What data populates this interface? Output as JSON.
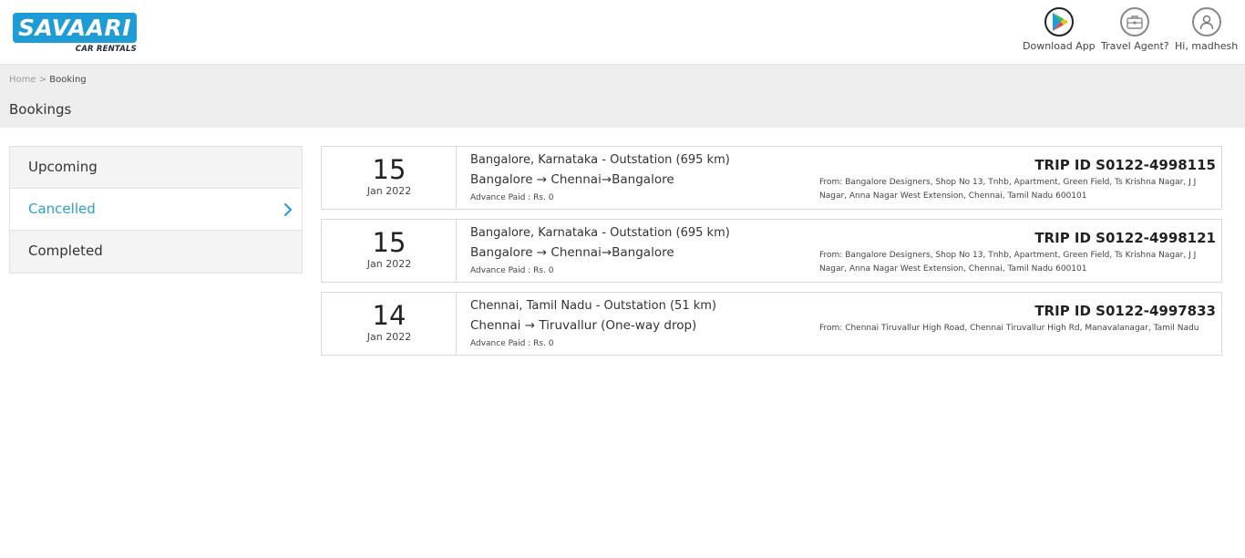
{
  "brand": {
    "name": "SAVAARI",
    "tagline": "CAR RENTALS",
    "color": "#1e9cd7"
  },
  "header": {
    "download_app": "Download App",
    "travel_agent": "Travel Agent?",
    "greeting": "Hi, madhesh"
  },
  "breadcrumb": {
    "home": "Home",
    "separator": ">",
    "current": "Booking"
  },
  "page_title": "Bookings",
  "sidebar": {
    "active_color": "#2b9fd3",
    "items": [
      {
        "label": "Upcoming"
      },
      {
        "label": "Cancelled"
      },
      {
        "label": "Completed"
      }
    ]
  },
  "bookings": [
    {
      "day": "15",
      "month_year": "Jan 2022",
      "route_title": "Bangalore, Karnataka - Outstation (695 km)",
      "path": "Bangalore → Chennai→Bangalore",
      "advance": "Advance Paid : Rs. 0",
      "trip_id": "TRIP ID S0122-4998115",
      "from_address": "From: Bangalore Designers, Shop No 13, Tnhb, Apartment, Green Field, Ts Krishna Nagar, J J Nagar, Anna Nagar West Extension, Chennai, Tamil Nadu 600101"
    },
    {
      "day": "15",
      "month_year": "Jan 2022",
      "route_title": "Bangalore, Karnataka - Outstation (695 km)",
      "path": "Bangalore → Chennai→Bangalore",
      "advance": "Advance Paid : Rs. 0",
      "trip_id": "TRIP ID S0122-4998121",
      "from_address": "From: Bangalore Designers, Shop No 13, Tnhb, Apartment, Green Field, Ts Krishna Nagar, J J Nagar, Anna Nagar West Extension, Chennai, Tamil Nadu 600101"
    },
    {
      "day": "14",
      "month_year": "Jan 2022",
      "route_title": "Chennai, Tamil Nadu - Outstation (51 km)",
      "path": "Chennai → Tiruvallur (One-way drop)",
      "advance": "Advance Paid : Rs. 0",
      "trip_id": "TRIP ID S0122-4997833",
      "from_address": "From: Chennai Tiruvallur High Road, Chennai Tiruvallur High Rd, Manavalanagar, Tamil Nadu"
    }
  ]
}
